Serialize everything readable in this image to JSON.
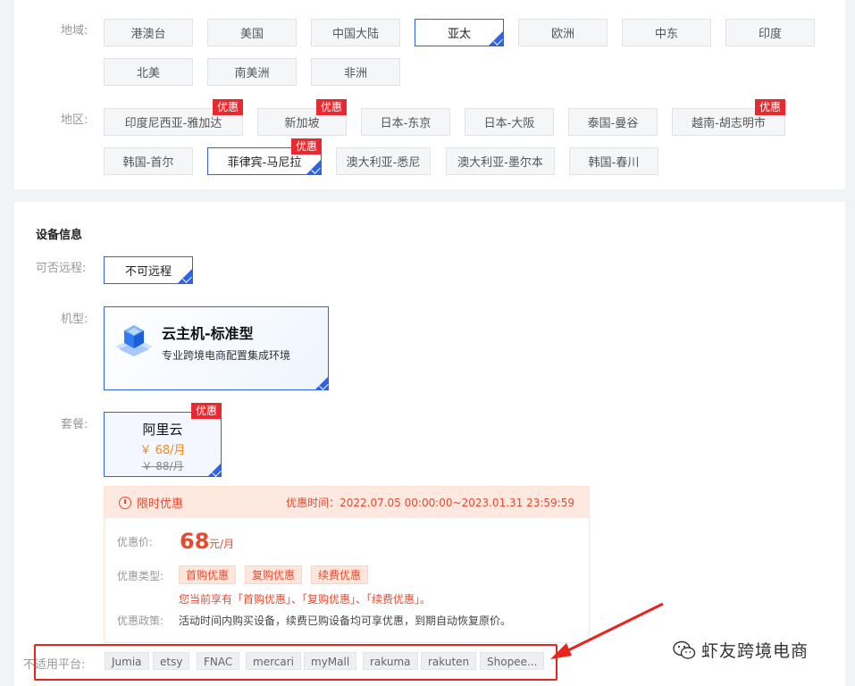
{
  "region_section": {
    "area_label": "地域:",
    "areas": [
      "港澳台",
      "美国",
      "中国大陆",
      "亚太",
      "欧洲",
      "中东",
      "印度",
      "北美",
      "南美洲",
      "非洲"
    ],
    "selected_area": "亚太",
    "district_label": "地区:",
    "districts": [
      "印度尼西亚-雅加达",
      "新加坡",
      "日本-东京",
      "日本-大阪",
      "泰国-曼谷",
      "越南-胡志明市",
      "韩国-首尔",
      "菲律宾-马尼拉",
      "澳大利亚-悉尼",
      "澳大利亚-墨尔本",
      "韩国-春川"
    ],
    "selected_district": "菲律宾-马尼拉",
    "promo_badge": "优惠"
  },
  "device_section": {
    "title": "设备信息",
    "remote_label": "可否远程:",
    "remote_value": "不可远程",
    "model_label": "机型:",
    "model_name": "云主机-标准型",
    "model_desc": "专业跨境电商配置集成环境",
    "plan_label": "套餐:",
    "plan_name": "阿里云",
    "plan_price": "￥ 68/月",
    "plan_old_price": "￥ 88/月",
    "promo_badge": "优惠"
  },
  "deal": {
    "title": "限时优惠",
    "time": "优惠时间：2022.07.05 00:00:00~2023.01.31 23:59:59",
    "price_label": "优惠价:",
    "price": "68",
    "unit": "元/月",
    "type_label": "优惠类型:",
    "types": [
      "首购优惠",
      "复购优惠",
      "续费优惠"
    ],
    "note": "您当前享有「首购优惠」、「复购优惠」、「续费优惠」。",
    "policy_label": "优惠政策:",
    "policy": "活动时间内购买设备，续费已购设备均可享优惠，到期自动恢复原价。"
  },
  "platforms": {
    "label": "不适用平台:",
    "items": [
      "Jumia",
      "etsy",
      "FNAC",
      "mercari",
      "myMall",
      "rakuma",
      "rakuten",
      "Shopee..."
    ]
  },
  "watermark": {
    "text": "虾友跨境电商"
  },
  "colors": {
    "accent": "#2f62e6",
    "promo": "#e8292f",
    "highlight_box": "#e8241c"
  }
}
